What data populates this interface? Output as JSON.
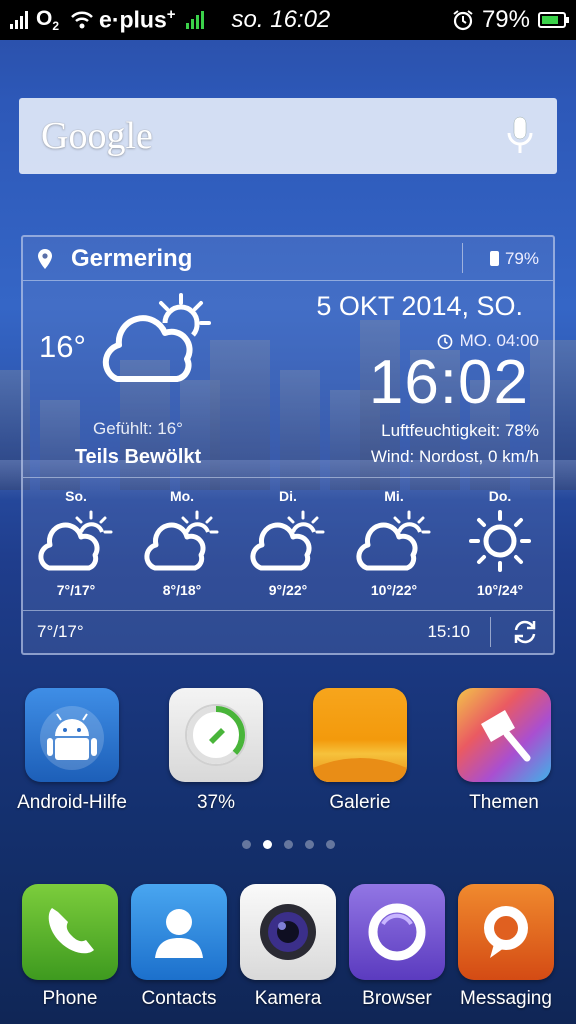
{
  "status_bar": {
    "operator_logo": "O",
    "operator_sub": "2",
    "carrier": "e·plus",
    "carrier_sup": "+",
    "time": "so. 16:02",
    "battery_percent": "79%",
    "battery_level": 0.79
  },
  "search": {
    "logo_text": "Google",
    "mic_icon": "microphone-icon"
  },
  "weather": {
    "city": "Germering",
    "battery": "79%",
    "current_temp": "16°",
    "condition_icon": "partly-cloudy-icon",
    "felt": "Gefühlt: 16°",
    "condition": "Teils Bewölkt",
    "date": "5 OKT 2014, SO.",
    "alarm": "MO. 04:00",
    "clock": "16:02",
    "humidity": "Luftfeuchtigkeit: 78%",
    "wind": "Wind: Nordost, 0 km/h",
    "forecast": [
      {
        "day": "So.",
        "temps": "7°/17°",
        "icon": "partly-cloudy-icon"
      },
      {
        "day": "Mo.",
        "temps": "8°/18°",
        "icon": "partly-cloudy-icon"
      },
      {
        "day": "Di.",
        "temps": "9°/22°",
        "icon": "partly-cloudy-icon"
      },
      {
        "day": "Mi.",
        "temps": "10°/22°",
        "icon": "partly-cloudy-icon"
      },
      {
        "day": "Do.",
        "temps": "10°/24°",
        "icon": "sun-icon"
      }
    ],
    "footer_temps": "7°/17°",
    "updated": "15:10"
  },
  "apps": [
    {
      "label": "Android-Hilfe",
      "icon": "android-help-icon"
    },
    {
      "label": "37%",
      "icon": "cleaner-icon",
      "progress": 0.37
    },
    {
      "label": "Galerie",
      "icon": "gallery-icon"
    },
    {
      "label": "Themen",
      "icon": "themes-icon"
    }
  ],
  "page_indicator": {
    "count": 5,
    "active": 1
  },
  "dock": [
    {
      "label": "Phone",
      "icon": "phone-icon",
      "color": "#58b22c"
    },
    {
      "label": "Contacts",
      "icon": "contacts-icon",
      "color": "#2f8ee0"
    },
    {
      "label": "Kamera",
      "icon": "camera-icon",
      "color": "#eeeeee"
    },
    {
      "label": "Browser",
      "icon": "browser-icon",
      "color": "#7b57d6"
    },
    {
      "label": "Messaging",
      "icon": "messaging-icon",
      "color": "#e8641c"
    }
  ]
}
